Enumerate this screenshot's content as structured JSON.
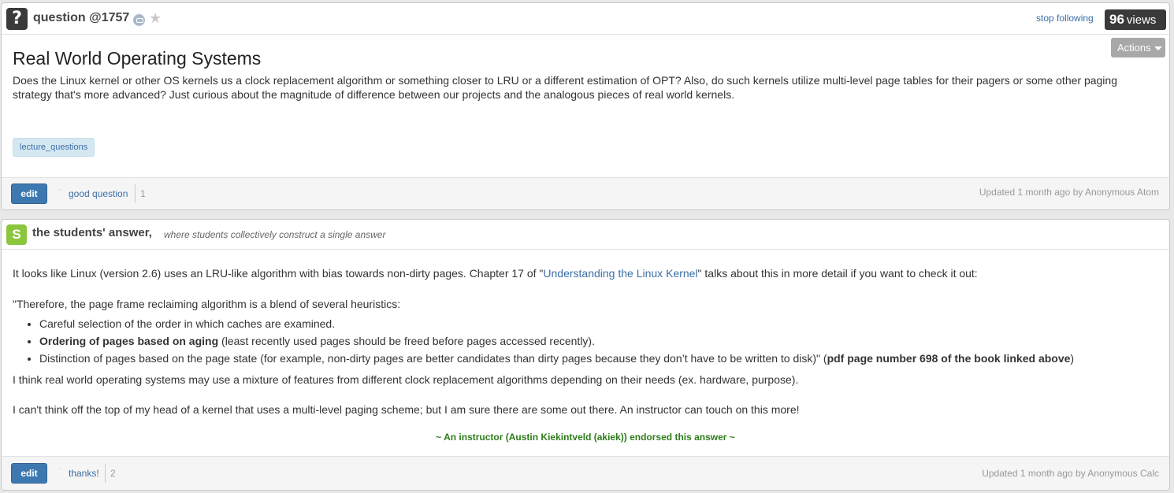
{
  "question": {
    "badge": "?",
    "label": "question @1757",
    "stop_following": "stop following",
    "views_count": "96",
    "views_label": "views",
    "actions_label": "Actions",
    "title": "Real World Operating Systems",
    "body": "Does the Linux kernel or other OS kernels us a clock replacement algorithm or something closer to LRU or a different estimation of OPT? Also, do such kernels utilize multi-level page tables for their pagers or some other paging strategy that's more advanced? Just curious about the magnitude of difference between our projects and the analogous pieces of real world kernels.",
    "tag": "lecture_questions",
    "edit_label": "edit",
    "good_question_label": "good question",
    "good_question_count": "1",
    "updated": "Updated 1 month ago by Anonymous Atom"
  },
  "answer": {
    "badge": "S",
    "title": "the students' answer,",
    "subtitle": "where students collectively construct a single answer",
    "para1_before": "It looks like Linux (version 2.6) uses an LRU-like algorithm with bias towards non-dirty pages. Chapter 17 of \"",
    "para1_link": "Understanding the Linux Kernel",
    "para1_after": "\" talks about this in more detail if you want to check it out:",
    "quote_intro": "\"Therefore, the page frame reclaiming algorithm is a blend of several heuristics:",
    "bullet1": "Careful selection of the order in which caches are examined.",
    "bullet2_bold": "Ordering of pages based on aging",
    "bullet2_rest": " (least recently used pages should be freed before pages accessed recently).",
    "bullet3_text": "Distinction of pages based on the page state (for example, non-dirty pages are better candidates than dirty pages because they don’t have to be written to disk)\" (",
    "bullet3_bold": "pdf page number 698 of the book linked above",
    "bullet3_close": ")",
    "para3": "I think real world operating systems may use a mixture of features from different clock replacement algorithms depending on their needs (ex. hardware, purpose).",
    "para4": "I can't think off the top of my head of a kernel that uses a multi-level paging scheme; but I am sure there are some out there. An instructor can touch on this more!",
    "endorsement": "~ An instructor (Austin Kiekintveld (akiek)) endorsed this answer  ~",
    "edit_label": "edit",
    "thanks_label": "thanks!",
    "thanks_count": "2",
    "updated": "Updated 1 month ago by Anonymous Calc"
  },
  "colors": {
    "link": "#3b6ea5",
    "edit_button": "#3d79b0",
    "student_badge": "#8cc63e",
    "endorse": "#2e7d1b",
    "tag_bg": "#d5e8f2"
  }
}
